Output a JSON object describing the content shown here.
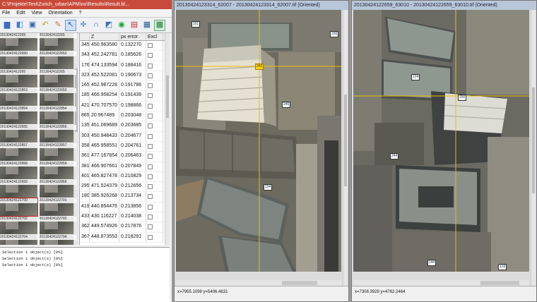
{
  "main_window": {
    "title": "C:\\Projekte\\Test\\Zurich_urban\\APM\\no\\Results\\Result.bl...",
    "menu": [
      "File",
      "Edit",
      "View",
      "Orientation",
      "?"
    ]
  },
  "thumbnails": {
    "labels": [
      [
        "2013042412265",
        "2013042412265"
      ],
      [
        "20130424122650",
        "20130424122652"
      ],
      [
        "2013042412265",
        "2013042412265"
      ],
      [
        "20130424122853",
        "20130424122653"
      ],
      [
        "20130424122854",
        "20130424122854"
      ],
      [
        "20130424122655",
        "20130424122855"
      ],
      [
        "20130424122857",
        "20130424122857"
      ],
      [
        "20130424122858",
        "20130424122859"
      ],
      [
        "20130424122659",
        "20130424122859"
      ],
      [
        "20130424122700",
        "20130424122701"
      ],
      [
        "20130424122702",
        "20130424122702"
      ],
      [
        "20130424122704",
        "20130424122704"
      ]
    ]
  },
  "table": {
    "headers": [
      "",
      "Z",
      "px error",
      "Excl"
    ],
    "rows": [
      [
        "345",
        "450.963580",
        "0.132270"
      ],
      [
        "343",
        "452.242781",
        "0.185626"
      ],
      [
        "176",
        "474.133594",
        "0.188416"
      ],
      [
        "323",
        "452.522081",
        "0.190673"
      ],
      [
        "165",
        "452.987228",
        "0.191786"
      ],
      [
        "185",
        "466.958254",
        "0.191439"
      ],
      [
        "421",
        "470.707570",
        "0.198866"
      ],
      [
        "865",
        "20.967489",
        "0.203048"
      ],
      [
        "135",
        "451.069689",
        "0.203685"
      ],
      [
        "303",
        "450.948433",
        "0.204677"
      ],
      [
        "358",
        "465.958551",
        "0.204761"
      ],
      [
        "361",
        "477.167854",
        "0.206463"
      ],
      [
        "381",
        "466.907661",
        "0.207849"
      ],
      [
        "401",
        "465.827478",
        "0.210829"
      ],
      [
        "295",
        "471.524379",
        "0.212656"
      ],
      [
        "180",
        "385.926268",
        "0.213734"
      ],
      [
        "419",
        "440.854476",
        "0.213856"
      ],
      [
        "433",
        "430.116227",
        "0.214038"
      ],
      [
        "362",
        "449.574926",
        "0.217876"
      ],
      [
        "367",
        "448.873553",
        "0.218291"
      ]
    ]
  },
  "log": {
    "lines": [
      "Selection 1 object(s) [0%]",
      "Selection 1 object(s) [0%]",
      "Selection 1 object(s) [0%]"
    ]
  },
  "image_window_1": {
    "title": "20130424123314_62007 - 20130424123314_62007.tif (Oriented)",
    "status": "x=7955.1099  y=5406.4631",
    "tags": [
      "161",
      "150",
      "242",
      "245",
      "104"
    ]
  },
  "image_window_2": {
    "title": "20130424122659_63010 - 20130424122659_63010.tif (Oriented)",
    "status": "x=7308.3929  y=4762.2464",
    "tags": [
      "124",
      "250",
      "244",
      "144",
      "133"
    ]
  }
}
